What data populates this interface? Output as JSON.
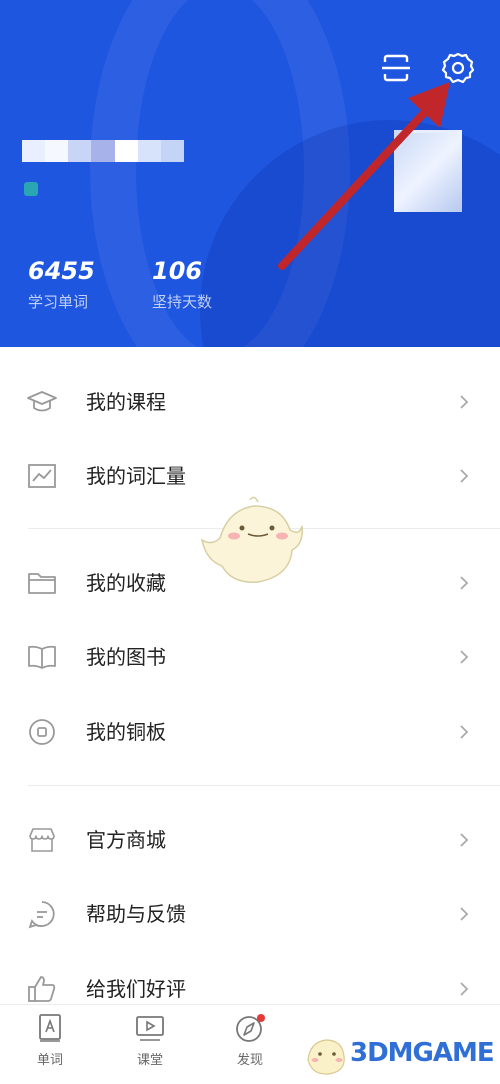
{
  "header": {
    "stats": [
      {
        "value": "6455",
        "label": "学习单词"
      },
      {
        "value": "106",
        "label": "坚持天数"
      }
    ],
    "colors": {
      "background": "#1f56e0",
      "arrow": "#c0262a"
    }
  },
  "menu": {
    "items": [
      {
        "label": "我的课程",
        "icon": "graduation-cap-icon"
      },
      {
        "label": "我的词汇量",
        "icon": "chart-icon"
      },
      {
        "label": "我的收藏",
        "icon": "folder-icon"
      },
      {
        "label": "我的图书",
        "icon": "book-icon"
      },
      {
        "label": "我的铜板",
        "icon": "coin-icon"
      },
      {
        "label": "官方商城",
        "icon": "store-icon"
      },
      {
        "label": "帮助与反馈",
        "icon": "chat-bubble-icon"
      },
      {
        "label": "给我们好评",
        "icon": "thumbs-up-icon"
      }
    ]
  },
  "tabbar": {
    "tabs": [
      {
        "label": "单词",
        "icon": "word-card-icon"
      },
      {
        "label": "课堂",
        "icon": "video-icon"
      },
      {
        "label": "发现",
        "icon": "compass-icon",
        "badge": true
      }
    ]
  },
  "watermark": {
    "text": "3DMGAME"
  }
}
